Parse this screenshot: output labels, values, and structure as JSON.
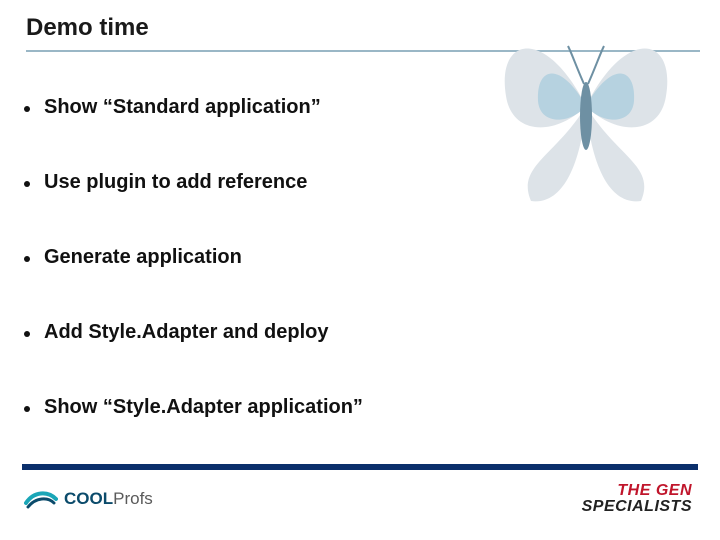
{
  "title": "Demo time",
  "bullets": [
    "Show “Standard application”",
    "Use plugin to add reference",
    "Generate application",
    "Add Style.Adapter and deploy",
    "Show “Style.Adapter application”"
  ],
  "footer": {
    "left_logo": {
      "cool": "COOL",
      "profs": "Profs"
    },
    "right_logo": {
      "line1": "THE GEN",
      "line2": "SPECIALISTS"
    }
  },
  "icons": {
    "butterfly": "butterfly-icon",
    "swoosh": "swoosh-icon"
  }
}
